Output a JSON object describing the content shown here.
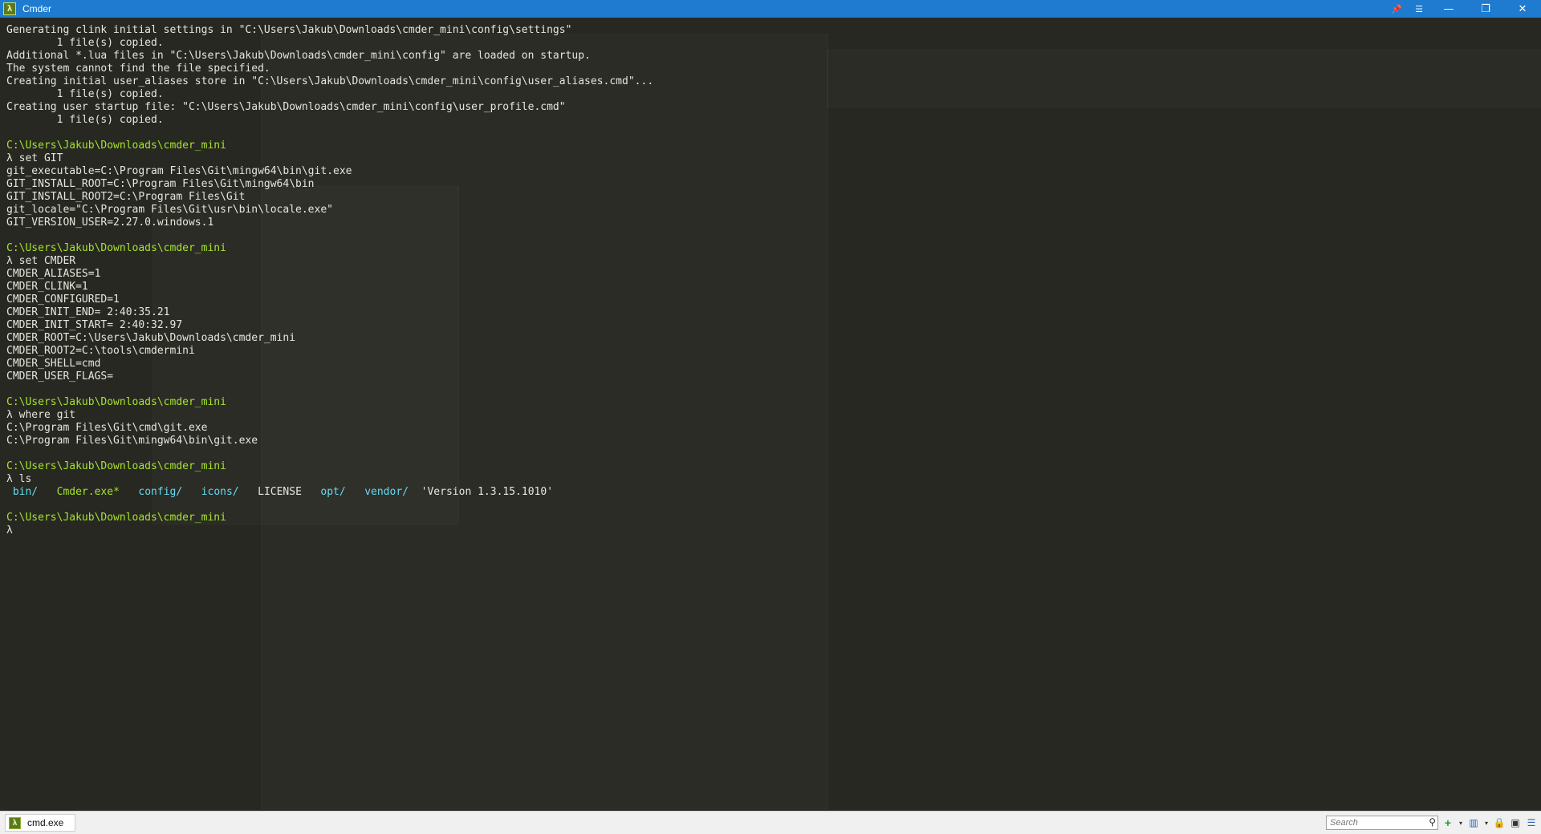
{
  "window": {
    "title": "Cmder",
    "app_icon_glyph": "λ",
    "pin_glyph": "📌",
    "menu_glyph": "☰",
    "minimize_glyph": "—",
    "restore_glyph": "❐",
    "close_glyph": "✕"
  },
  "console": {
    "lines": [
      {
        "t": "Generating clink initial settings in \"C:\\Users\\Jakub\\Downloads\\cmder_mini\\config\\settings\""
      },
      {
        "t": "        1 file(s) copied."
      },
      {
        "t": "Additional *.lua files in \"C:\\Users\\Jakub\\Downloads\\cmder_mini\\config\" are loaded on startup."
      },
      {
        "t": "The system cannot find the file specified."
      },
      {
        "t": "Creating initial user_aliases store in \"C:\\Users\\Jakub\\Downloads\\cmder_mini\\config\\user_aliases.cmd\"..."
      },
      {
        "t": "        1 file(s) copied."
      },
      {
        "t": "Creating user startup file: \"C:\\Users\\Jakub\\Downloads\\cmder_mini\\config\\user_profile.cmd\""
      },
      {
        "t": "        1 file(s) copied."
      },
      {
        "t": ""
      },
      {
        "t": "C:\\Users\\Jakub\\Downloads\\cmder_mini",
        "c": "path"
      },
      {
        "t": "λ set GIT"
      },
      {
        "t": "git_executable=C:\\Program Files\\Git\\mingw64\\bin\\git.exe"
      },
      {
        "t": "GIT_INSTALL_ROOT=C:\\Program Files\\Git\\mingw64\\bin"
      },
      {
        "t": "GIT_INSTALL_ROOT2=C:\\Program Files\\Git"
      },
      {
        "t": "git_locale=\"C:\\Program Files\\Git\\usr\\bin\\locale.exe\""
      },
      {
        "t": "GIT_VERSION_USER=2.27.0.windows.1"
      },
      {
        "t": ""
      },
      {
        "t": "C:\\Users\\Jakub\\Downloads\\cmder_mini",
        "c": "path"
      },
      {
        "t": "λ set CMDER"
      },
      {
        "t": "CMDER_ALIASES=1"
      },
      {
        "t": "CMDER_CLINK=1"
      },
      {
        "t": "CMDER_CONFIGURED=1"
      },
      {
        "t": "CMDER_INIT_END= 2:40:35.21"
      },
      {
        "t": "CMDER_INIT_START= 2:40:32.97"
      },
      {
        "t": "CMDER_ROOT=C:\\Users\\Jakub\\Downloads\\cmder_mini"
      },
      {
        "t": "CMDER_ROOT2=C:\\tools\\cmdermini"
      },
      {
        "t": "CMDER_SHELL=cmd"
      },
      {
        "t": "CMDER_USER_FLAGS="
      },
      {
        "t": ""
      },
      {
        "t": "C:\\Users\\Jakub\\Downloads\\cmder_mini",
        "c": "path"
      },
      {
        "t": "λ where git"
      },
      {
        "t": "C:\\Program Files\\Git\\cmd\\git.exe"
      },
      {
        "t": "C:\\Program Files\\Git\\mingw64\\bin\\git.exe"
      },
      {
        "t": ""
      },
      {
        "t": "C:\\Users\\Jakub\\Downloads\\cmder_mini",
        "c": "path"
      },
      {
        "t": "λ ls"
      }
    ],
    "ls_output": [
      {
        "t": " bin/",
        "c": "dir"
      },
      {
        "t": "   "
      },
      {
        "t": "Cmder.exe*",
        "c": "path"
      },
      {
        "t": "   "
      },
      {
        "t": "config/",
        "c": "dir"
      },
      {
        "t": "   "
      },
      {
        "t": "icons/",
        "c": "dir"
      },
      {
        "t": "   "
      },
      {
        "t": "LICENSE",
        "c": "norm"
      },
      {
        "t": "   "
      },
      {
        "t": "opt/",
        "c": "dir"
      },
      {
        "t": "   "
      },
      {
        "t": "vendor/",
        "c": "dir"
      },
      {
        "t": "  "
      },
      {
        "t": "'Version 1.3.15.1010'",
        "c": "norm"
      }
    ],
    "after_lines": [
      {
        "t": ""
      },
      {
        "t": "C:\\Users\\Jakub\\Downloads\\cmder_mini",
        "c": "path"
      },
      {
        "t": "λ "
      }
    ],
    "colors": {
      "background": "#272822",
      "text": "#e6e6dc",
      "path": "#a6e22e",
      "directory": "#66d9ef"
    }
  },
  "statusbar": {
    "tab_label": "cmd.exe",
    "tab_icon_glyph": "λ",
    "search_placeholder": "Search",
    "search_glyph": "⚲",
    "add_glyph": "+",
    "dropdown_glyph": "▾",
    "layout_glyph": "▥",
    "lock_glyph": "🔒",
    "panel_glyph": "▣",
    "menu_glyph": "☰"
  }
}
